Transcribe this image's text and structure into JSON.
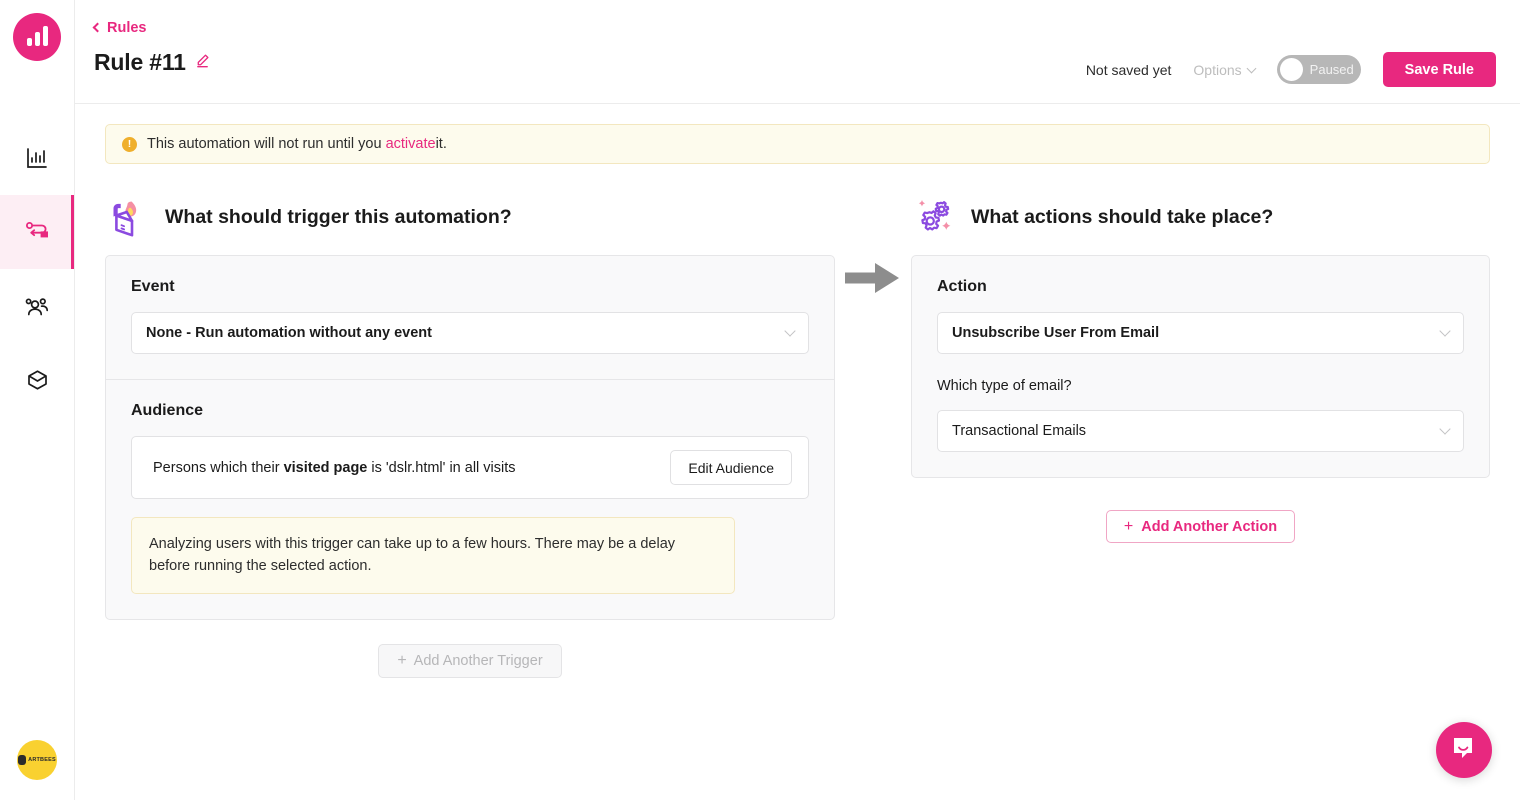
{
  "sidebar": {
    "logo_name": "jabmo-logo",
    "items": [
      {
        "name": "analytics",
        "icon": "bar-chart-icon",
        "active": false
      },
      {
        "name": "rules",
        "icon": "automation-flow-icon",
        "active": true
      },
      {
        "name": "audience",
        "icon": "people-icon",
        "active": false
      },
      {
        "name": "products",
        "icon": "box-icon",
        "active": false
      }
    ],
    "avatar_label": "ARTBEES"
  },
  "header": {
    "breadcrumb": "Rules",
    "title": "Rule #11",
    "edit_icon": "pencil-icon",
    "save_state": "Not saved yet",
    "options_label": "Options",
    "toggle_label": "Paused",
    "toggle_on": false,
    "save_label": "Save Rule"
  },
  "banner": {
    "text_before": "This automation will not run until you",
    "link": "activate",
    "text_after": "it."
  },
  "trigger": {
    "heading": "What should trigger this automation?",
    "icon": "lighter-flame-icon",
    "event_label": "Event",
    "event_value": "None - Run automation without any event",
    "audience_label": "Audience",
    "audience_text_1": "Persons which their ",
    "audience_text_bold": "visited page",
    "audience_text_2": " is 'dslr.html' in all visits",
    "edit_audience_label": "Edit Audience",
    "note": "Analyzing users with this trigger can take up to a few hours. There may be a delay before running the selected action.",
    "add_trigger_label": "Add Another Trigger"
  },
  "action": {
    "heading": "What actions should take place?",
    "icon": "gears-sparkle-icon",
    "action_label": "Action",
    "action_value": "Unsubscribe User From Email",
    "email_type_label": "Which type of email?",
    "email_type_value": "Transactional Emails",
    "add_action_label": "Add Another Action"
  },
  "support": {
    "icon": "chat-bubble-icon"
  },
  "colors": {
    "accent": "#e8287f",
    "warning_bg": "#fdfbed",
    "warning_border": "#f3e7bf",
    "warning_icon": "#efaf2c",
    "card_bg": "#f9f9fa",
    "avatar_bg": "#f9d130",
    "toggle_off": "#b7b7b7"
  }
}
